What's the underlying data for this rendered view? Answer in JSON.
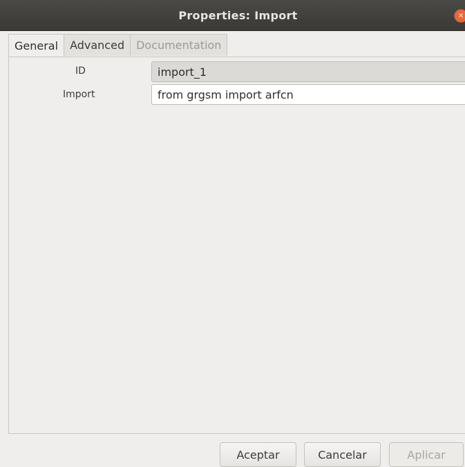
{
  "window": {
    "title": "Properties: Import",
    "close_icon": "close-icon"
  },
  "tabs": [
    {
      "label": "General",
      "state": "active"
    },
    {
      "label": "Advanced",
      "state": "normal"
    },
    {
      "label": "Documentation",
      "state": "disabled"
    }
  ],
  "params": {
    "id_label": "ID",
    "id_value": "import_1",
    "import_label": "Import",
    "import_value": "from grgsm import arfcn"
  },
  "buttons": {
    "ok": "Aceptar",
    "cancel": "Cancelar",
    "apply": "Aplicar"
  },
  "colors": {
    "titlebar": "#3e3d39",
    "close_button": "#e9683a"
  }
}
